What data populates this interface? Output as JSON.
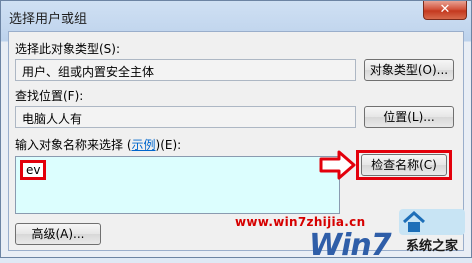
{
  "window": {
    "title": "选择用户或组",
    "close_symbol": "✕"
  },
  "object_type": {
    "label": "选择此对象类型(S):",
    "value": "用户、组或内置安全主体",
    "button": "对象类型(O)..."
  },
  "location": {
    "label": "查找位置(F):",
    "value": "电脑人人有",
    "button": "位置(L)..."
  },
  "names": {
    "label_prefix": "输入对象名称来选择 (",
    "label_link": "示例",
    "label_suffix": ")(E):",
    "value": "ev",
    "check_button": "检查名称(C)"
  },
  "advanced_button": "高级(A)...",
  "watermark": {
    "url": "www.win7zhijia.cn",
    "logo_word": "Win7",
    "site_name": "系统之家"
  },
  "colors": {
    "highlight_red": "#e3000b",
    "textarea_bg": "#dcfefe"
  }
}
